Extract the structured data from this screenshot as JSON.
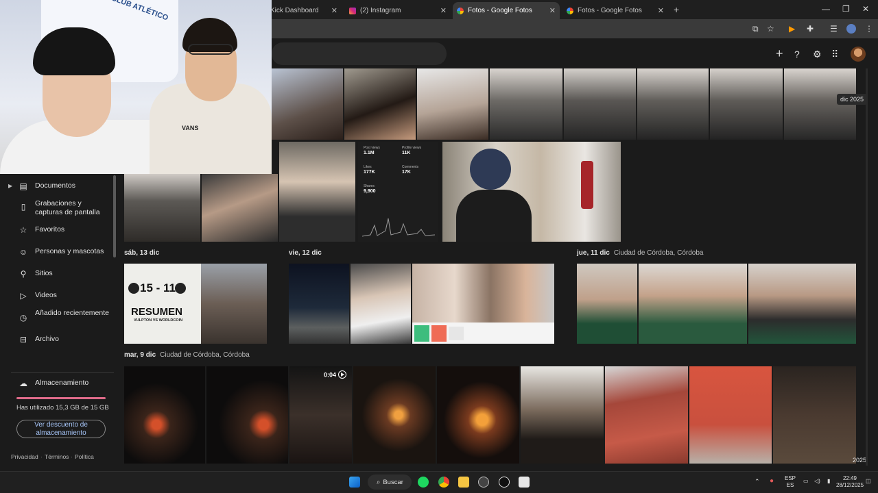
{
  "browser": {
    "tabs": [
      {
        "title": "Kick Dashboard",
        "active": false
      },
      {
        "title": "(2) Instagram",
        "active": false
      },
      {
        "title": "Fotos - Google Fotos",
        "active": true
      },
      {
        "title": "Fotos - Google Fotos",
        "active": false
      }
    ],
    "new_tab_icon": "plus-icon"
  },
  "webcam": {
    "banner_text": "CLUB ATLÉTICO",
    "shirt_text": "VANS"
  },
  "sidebar": {
    "items": [
      {
        "label": "Documentos",
        "icon": "document-icon",
        "expandable": true
      },
      {
        "label": "Grabaciones y capturas de pantalla",
        "icon": "phone-icon",
        "expandable": false
      },
      {
        "label": "Favoritos",
        "icon": "star-icon",
        "expandable": false
      },
      {
        "label": "Personas y mascotas",
        "icon": "face-icon",
        "expandable": false
      },
      {
        "label": "Sitios",
        "icon": "pin-icon",
        "expandable": false
      },
      {
        "label": "Videos",
        "icon": "play-icon",
        "expandable": false
      },
      {
        "label": "Añadido recientemente",
        "icon": "clock-icon",
        "expandable": false
      },
      {
        "label": "Archivo",
        "icon": "archive-icon",
        "expandable": false
      }
    ],
    "storage": {
      "title": "Almacenamiento",
      "usage": "Has utilizado 15,3 GB de 15 GB",
      "button": "Ver descuento de almacenamiento",
      "fill_fraction": 1.0
    },
    "footer": [
      "Privacidad",
      "Términos",
      "Política"
    ]
  },
  "grid": {
    "top_year_badge": "dic 2025",
    "sections": [
      {
        "date": "sáb, 13 dic",
        "location": ""
      },
      {
        "date": "vie, 12 dic",
        "location": ""
      },
      {
        "date": "jue, 11 dic",
        "location": "Ciudad de Córdoba, Córdoba"
      },
      {
        "date": "mar, 9 dic",
        "location": "Ciudad de Córdoba, Córdoba"
      }
    ],
    "video_duration": "0:04",
    "bottom_year_badge": "2025"
  },
  "stats_card": {
    "post_views": {
      "label": "Post views",
      "value": "1.1M"
    },
    "profile_views": {
      "label": "Profile views",
      "value": "11K"
    },
    "likes": {
      "label": "Likes",
      "value": "177K"
    },
    "comments": {
      "label": "Comments",
      "value": "17K"
    },
    "shares": {
      "label": "Shares",
      "value": "9,900"
    }
  },
  "resumen": {
    "score": "15 - 11",
    "title": "RESUMEN",
    "subtitle": "VULPTON VS WORLDCOIN"
  },
  "taskbar": {
    "search_label": "Buscar",
    "lang_top": "ESP",
    "lang_bottom": "ES",
    "time": "22:49",
    "date": "28/12/2025"
  },
  "colors": {
    "background": "#1b1b1b",
    "accent_link": "#a8c7fa",
    "storage_full": "#e06b8a"
  }
}
